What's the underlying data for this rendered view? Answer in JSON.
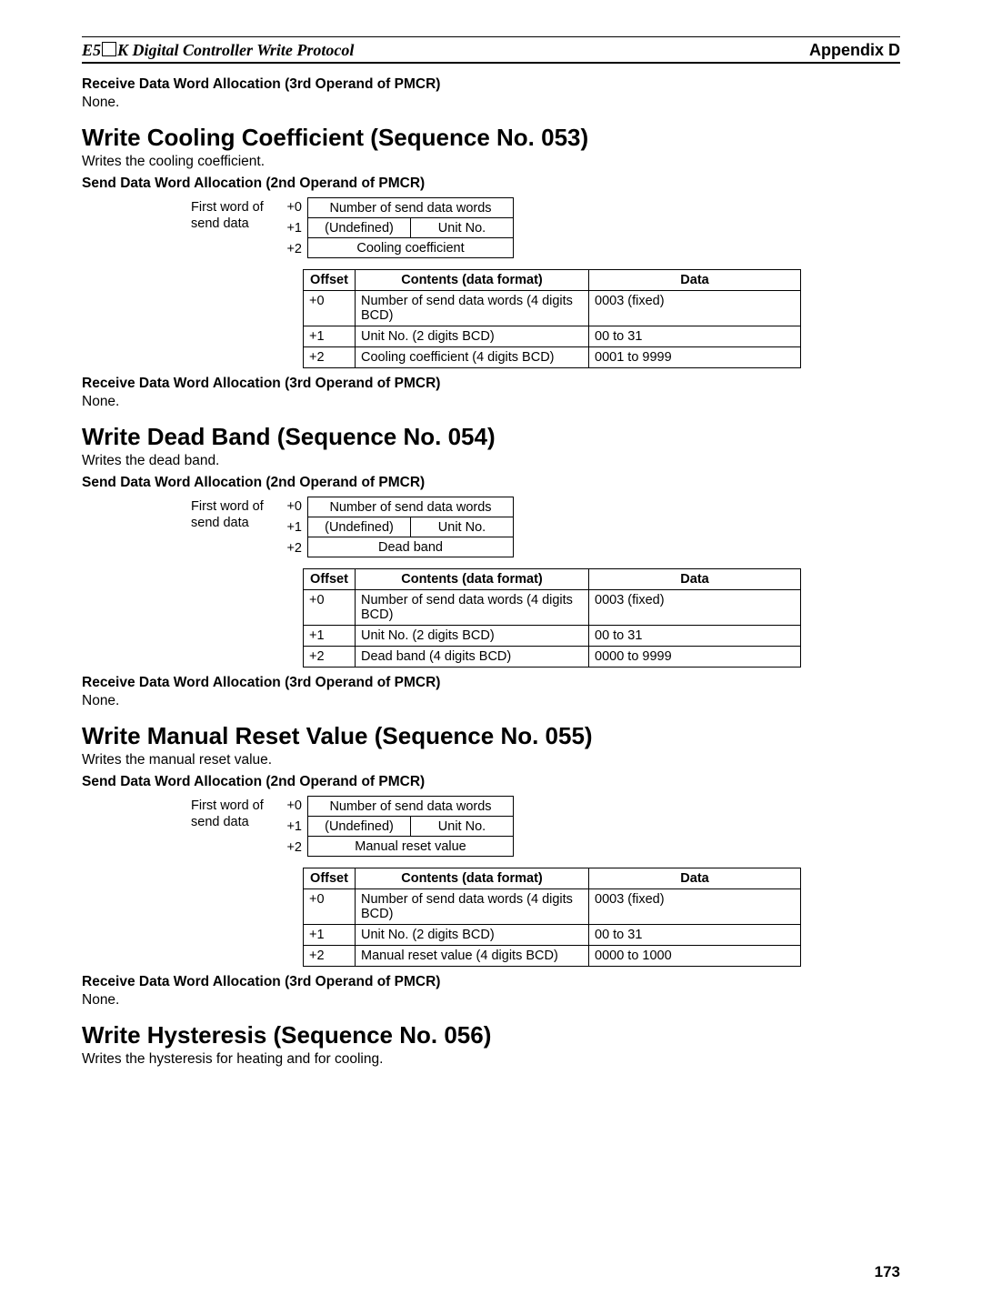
{
  "header": {
    "left_pre": "E5",
    "left_post": "K Digital Controller Write Protocol",
    "right": "Appendix D"
  },
  "page_number": "173",
  "top_receive": {
    "heading": "Receive Data Word Allocation (3rd Operand of PMCR)",
    "text": "None."
  },
  "sections": [
    {
      "title": "Write Cooling Coefficient (Sequence No. 053)",
      "desc": "Writes the cooling coefficient.",
      "send_heading": "Send Data Word Allocation (2nd Operand of PMCR)",
      "diagram_caption": "First word of send data",
      "diagram": {
        "offsets": [
          "+0",
          "+1",
          "+2"
        ],
        "rows": [
          {
            "type": "full",
            "cells": [
              "Number of send data words"
            ]
          },
          {
            "type": "split",
            "cells": [
              "(Undefined)",
              "Unit No."
            ]
          },
          {
            "type": "full",
            "cells": [
              "Cooling coefficient"
            ]
          }
        ]
      },
      "table": {
        "headers": [
          "Offset",
          "Contents (data format)",
          "Data"
        ],
        "rows": [
          [
            "+0",
            "Number of send data words (4 digits BCD)",
            "0003 (fixed)"
          ],
          [
            "+1",
            "Unit No. (2 digits BCD)",
            "00 to 31"
          ],
          [
            "+2",
            "Cooling coefficient (4 digits BCD)",
            "0001 to 9999"
          ]
        ]
      },
      "receive": {
        "heading": "Receive Data Word Allocation (3rd Operand of PMCR)",
        "text": "None."
      }
    },
    {
      "title": "Write Dead Band (Sequence No. 054)",
      "desc": "Writes the dead band.",
      "send_heading": "Send Data Word Allocation (2nd Operand of PMCR)",
      "diagram_caption": "First word of send data",
      "diagram": {
        "offsets": [
          "+0",
          "+1",
          "+2"
        ],
        "rows": [
          {
            "type": "full",
            "cells": [
              "Number of send data words"
            ]
          },
          {
            "type": "split",
            "cells": [
              "(Undefined)",
              "Unit No."
            ]
          },
          {
            "type": "full",
            "cells": [
              "Dead band"
            ]
          }
        ]
      },
      "table": {
        "headers": [
          "Offset",
          "Contents (data format)",
          "Data"
        ],
        "rows": [
          [
            "+0",
            "Number of send data words (4 digits BCD)",
            "0003 (fixed)"
          ],
          [
            "+1",
            "Unit No. (2 digits BCD)",
            "00 to 31"
          ],
          [
            "+2",
            "Dead band (4 digits BCD)",
            "0000 to 9999"
          ]
        ]
      },
      "receive": {
        "heading": "Receive Data Word Allocation (3rd Operand of PMCR)",
        "text": "None."
      }
    },
    {
      "title": "Write Manual Reset Value (Sequence No. 055)",
      "desc": "Writes the manual reset value.",
      "send_heading": "Send Data Word Allocation (2nd Operand of PMCR)",
      "diagram_caption": "First word of send data",
      "diagram": {
        "offsets": [
          "+0",
          "+1",
          "+2"
        ],
        "rows": [
          {
            "type": "full",
            "cells": [
              "Number of send data words"
            ]
          },
          {
            "type": "split",
            "cells": [
              "(Undefined)",
              "Unit No."
            ]
          },
          {
            "type": "full",
            "cells": [
              "Manual reset value"
            ]
          }
        ]
      },
      "table": {
        "headers": [
          "Offset",
          "Contents (data format)",
          "Data"
        ],
        "rows": [
          [
            "+0",
            "Number of send data words (4 digits BCD)",
            "0003 (fixed)"
          ],
          [
            "+1",
            "Unit No. (2 digits BCD)",
            "00 to 31"
          ],
          [
            "+2",
            "Manual reset value (4 digits BCD)",
            "0000 to 1000"
          ]
        ]
      },
      "receive": {
        "heading": "Receive Data Word Allocation (3rd Operand of PMCR)",
        "text": "None."
      }
    },
    {
      "title": "Write Hysteresis (Sequence No. 056)",
      "desc": "Writes the hysteresis for heating and for cooling."
    }
  ]
}
